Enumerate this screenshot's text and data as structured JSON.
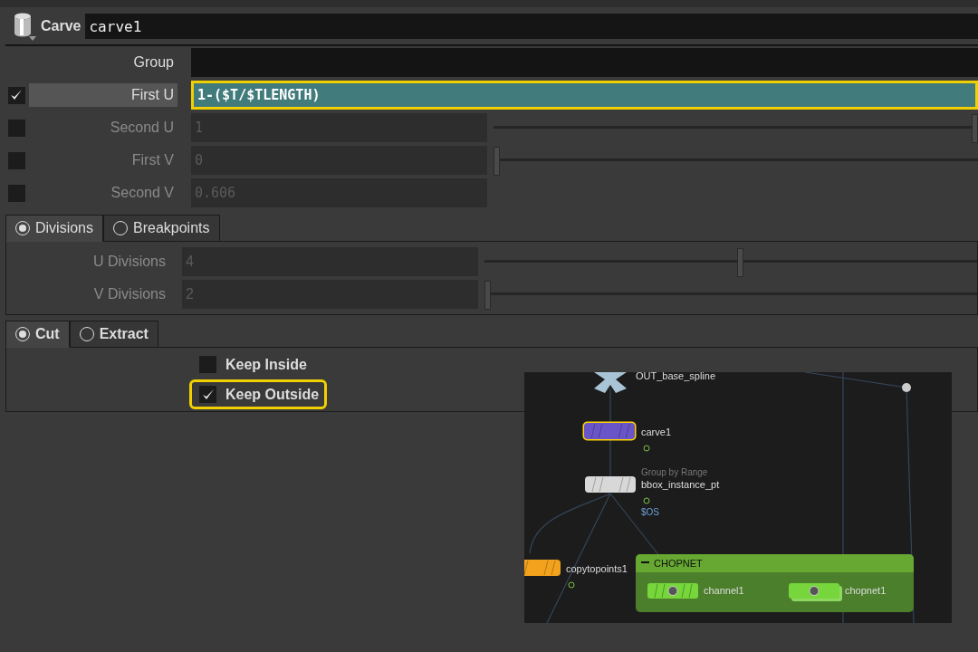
{
  "node": {
    "type_label": "Carve",
    "name": "carve1"
  },
  "group": {
    "label": "Group"
  },
  "params": [
    {
      "label": "First U",
      "value": "1-($T/$TLENGTH)",
      "checked": true,
      "highlighted": true,
      "kind": "expression"
    },
    {
      "label": "Second U",
      "value": "1",
      "checked": false,
      "highlighted": false,
      "kind": "slider",
      "level": 1
    },
    {
      "label": "First V",
      "value": "0",
      "checked": false,
      "highlighted": false,
      "kind": "slider",
      "level": 0
    },
    {
      "label": "Second V",
      "value": "0.606",
      "checked": false,
      "highlighted": false,
      "kind": "field"
    }
  ],
  "division_tabs": [
    {
      "label": "Divisions",
      "selected": true
    },
    {
      "label": "Breakpoints",
      "selected": false
    }
  ],
  "division_params": [
    {
      "label": "U Divisions",
      "value": "4",
      "level": 0.52
    },
    {
      "label": "V Divisions",
      "value": "2",
      "level": 0
    }
  ],
  "mode_tabs": [
    {
      "label": "Cut",
      "selected": true
    },
    {
      "label": "Extract",
      "selected": false
    }
  ],
  "keep_options": [
    {
      "label": "Keep Inside",
      "checked": false,
      "highlighted": false
    },
    {
      "label": "Keep Outside",
      "checked": true,
      "highlighted": true
    }
  ],
  "network": {
    "nodes": [
      {
        "name": "OUT_base_spline",
        "kind": "null",
        "selected": false,
        "color": "#a9c4d6"
      },
      {
        "name": "carve1",
        "kind": "sop",
        "selected": true,
        "color": "#6a55c8"
      },
      {
        "name": "bbox_instance_pt",
        "kind": "sop",
        "selected": false,
        "color": "#d8d8d8",
        "subtitle": "Group by Range",
        "expression": "$OS"
      },
      {
        "name": "copytopoints1",
        "kind": "sop",
        "selected": false,
        "color": "#f2a21c"
      }
    ],
    "box": {
      "title": "CHOPNET",
      "nodes": [
        {
          "name": "channel1",
          "kind": "chop"
        },
        {
          "name": "chopnet1",
          "kind": "net"
        }
      ]
    }
  }
}
